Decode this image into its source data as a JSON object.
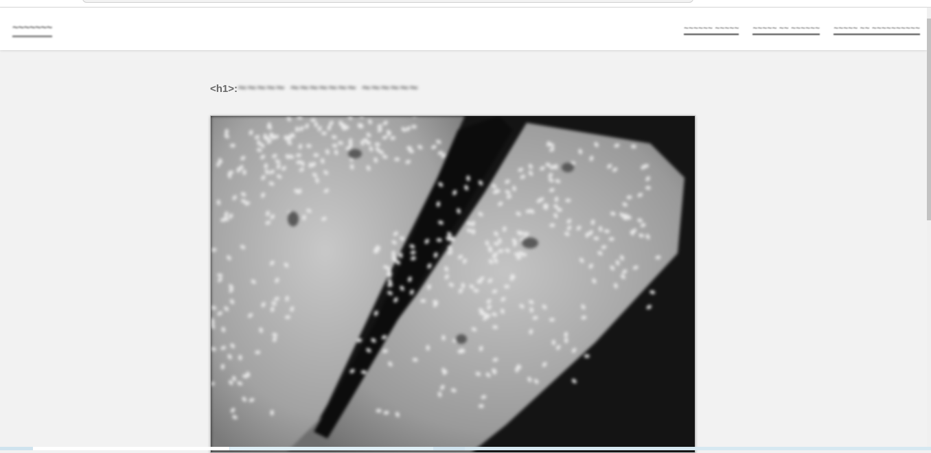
{
  "browser": {
    "address_bar": ""
  },
  "navbar": {
    "brand": "~~~~~~~",
    "links": [
      {
        "label": "~~~~~~ ~~~~~"
      },
      {
        "label": "~~~~~ ~~ ~~~~~~"
      },
      {
        "label": "~~~~~ ~~ ~~~~~~~~~~"
      }
    ]
  },
  "main": {
    "heading_tag": "<h1>:",
    "heading_text": "~~~~~ ~~~~~~~ ~~~~~~",
    "photo": {
      "alt": "",
      "icon": "food-photo-salmon-sesame"
    }
  },
  "colors": {
    "page_background": "#f2f2f2",
    "navbar_background": "#ffffff",
    "link_color": "#444444"
  }
}
